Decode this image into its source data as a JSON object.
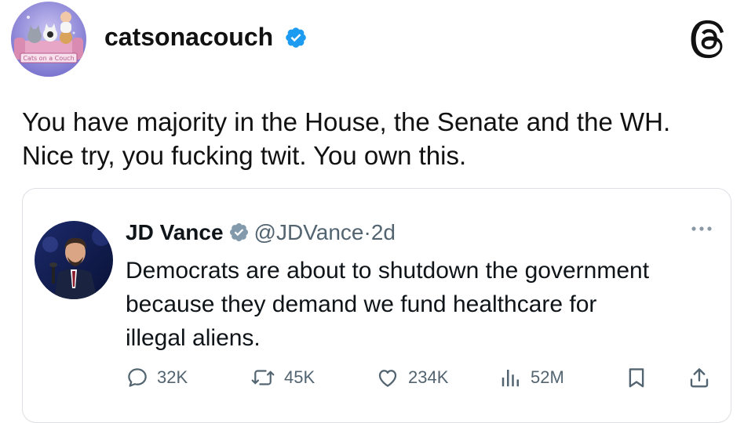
{
  "post": {
    "username": "catsonacouch",
    "text_lines": [
      "You have majority in the House, the Senate and the WH.",
      "Nice try, you fucking twit. You own this."
    ],
    "avatar_badge_text": "Cats on a Couch"
  },
  "quoted": {
    "name": "JD Vance",
    "handle": "@JDVance",
    "separator": "·",
    "age": "2d",
    "text_lines": [
      "Democrats are about to shutdown the government",
      "because they demand we fund healthcare for",
      "illegal aliens."
    ],
    "actions": {
      "replies": "32K",
      "reposts": "45K",
      "likes": "234K",
      "views": "52M"
    }
  },
  "colors": {
    "verified_blue": "#1d9bf0",
    "muted_gray": "#536471",
    "text_dark": "#0f1419"
  },
  "icons": [
    "verified-badge-icon",
    "threads-logo-icon",
    "more-icon",
    "reply-icon",
    "repost-icon",
    "like-icon",
    "views-icon",
    "bookmark-icon",
    "share-icon"
  ]
}
